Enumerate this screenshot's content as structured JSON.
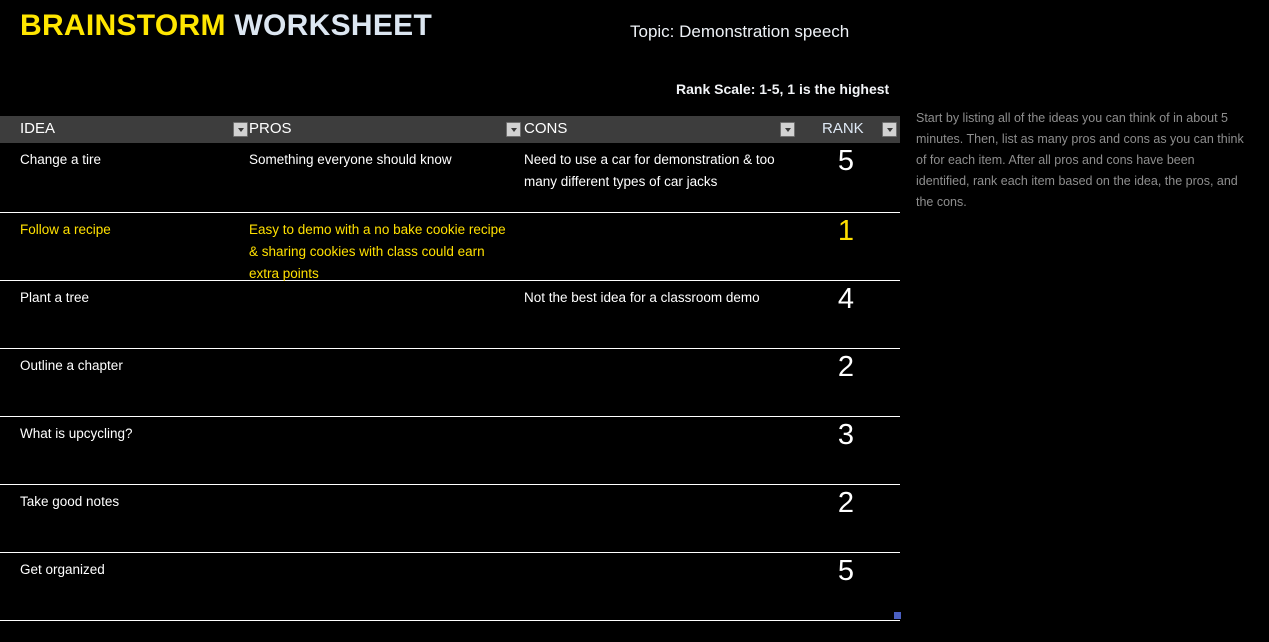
{
  "header": {
    "title_part1": "BRAINSTORM",
    "title_part2": "WORKSHEET",
    "topic": "Topic: Demonstration speech",
    "rank_scale": "Rank Scale: 1-5, 1 is the highest",
    "title_color_1": "#ffe600",
    "title_color_2": "#dce6f1"
  },
  "instructions": {
    "text": "Start by listing all of the ideas you can think of in about 5 minutes. Then, list as many pros and cons as you can think of for each item. After all pros and cons have been identified, rank each item based on the idea, the pros, and the cons."
  },
  "table": {
    "columns": [
      {
        "key": "idea",
        "label": "IDEA",
        "filter_icon": "filter-dropdown-icon"
      },
      {
        "key": "pros",
        "label": "PROS",
        "filter_icon": "filter-dropdown-icon"
      },
      {
        "key": "cons",
        "label": "CONS",
        "filter_icon": "filter-dropdown-icon"
      },
      {
        "key": "rank",
        "label": "RANK",
        "filter_icon": "filter-dropdown-icon"
      }
    ],
    "header_bg": "#3d3d3d",
    "highlight_color": "#ffe000",
    "rows": [
      {
        "idea": "Change a tire",
        "pros": "Something everyone should know",
        "cons": "Need to use a car for demonstration & too many different types of car jacks",
        "rank": "5",
        "highlighted": false
      },
      {
        "idea": "Follow a recipe",
        "pros": "Easy to demo with a no bake cookie recipe & sharing cookies with class could earn extra points",
        "cons": "",
        "rank": "1",
        "highlighted": true
      },
      {
        "idea": "Plant a tree",
        "pros": "",
        "cons": "Not the best idea for a classroom demo",
        "rank": "4",
        "highlighted": false
      },
      {
        "idea": "Outline a chapter",
        "pros": "",
        "cons": "",
        "rank": "2",
        "highlighted": false
      },
      {
        "idea": "What is upcycling?",
        "pros": "",
        "cons": "",
        "rank": "3",
        "highlighted": false
      },
      {
        "idea": "Take good notes",
        "pros": "",
        "cons": "",
        "rank": "2",
        "highlighted": false
      },
      {
        "idea": "Get organized",
        "pros": "",
        "cons": "",
        "rank": "5",
        "highlighted": false
      }
    ]
  }
}
